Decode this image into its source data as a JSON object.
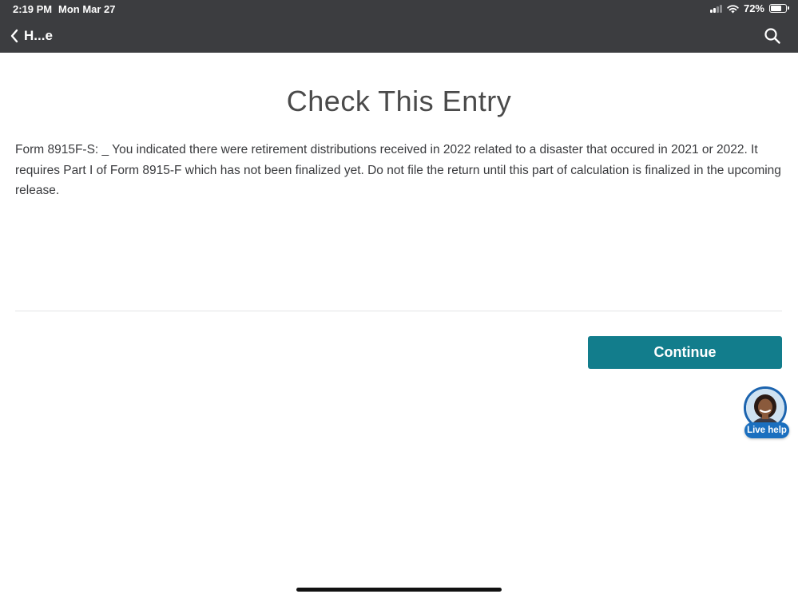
{
  "status_bar": {
    "time": "2:19 PM",
    "date": "Mon Mar 27",
    "battery_percent": "72%",
    "battery_level": 0.72,
    "icons": [
      "signal-icon",
      "wifi-icon",
      "battery-icon"
    ]
  },
  "nav": {
    "back_label": "H...e",
    "back_icon": "chevron-left-icon",
    "search_icon": "search-icon"
  },
  "main": {
    "title": "Check This Entry",
    "message": "Form 8915F-S: _ You indicated there were retirement distributions received in 2022 related to a disaster that occured in 2021 or 2022. It requires Part I of Form 8915-F which has not been finalized yet. Do not file the return until this part of calculation is finalized in the upcoming release.",
    "continue_label": "Continue"
  },
  "live_help": {
    "label": "Live help",
    "avatar_icon": "agent-avatar-icon"
  },
  "colors": {
    "header_bg": "#3c3d40",
    "primary_button": "#127d8c",
    "live_help_blue": "#1b6fbf",
    "title_text": "#4a4a4a",
    "body_text": "#393a3d"
  }
}
